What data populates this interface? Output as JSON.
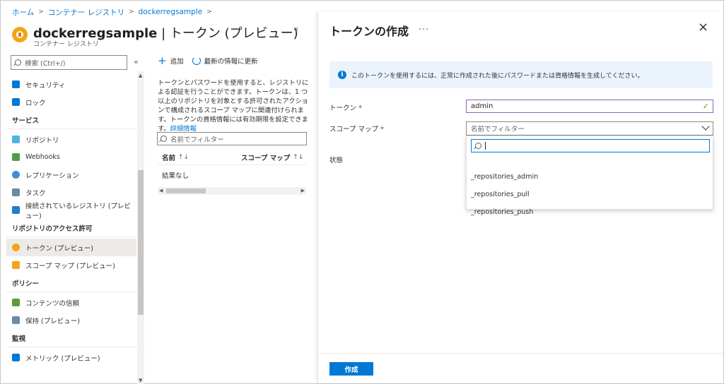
{
  "breadcrumb": [
    "ホーム",
    "コンテナー レジストリ",
    "dockerregsample"
  ],
  "header": {
    "title_bold": "dockerregsample",
    "title_rest": " | トークン (プレビュー)",
    "subtitle": "コンテナー レジストリ",
    "collapse": "«"
  },
  "nav": {
    "search_placeholder": "検索 (Ctrl+/)",
    "collapse": "«",
    "items": [
      {
        "type": "item",
        "label": "セキュリティ",
        "icon": "shield-icon",
        "color": "#0078d4"
      },
      {
        "type": "item",
        "label": "ロック",
        "icon": "lock-icon",
        "color": "#0078d4"
      },
      {
        "type": "section",
        "label": "サービス"
      },
      {
        "type": "item",
        "label": "リポジトリ",
        "icon": "cloud-icon",
        "color": "#50b0e8"
      },
      {
        "type": "item",
        "label": "Webhooks",
        "icon": "webhook-icon",
        "color": "#4c9e4c"
      },
      {
        "type": "item",
        "label": "レプリケーション",
        "icon": "globe-icon",
        "color": "#3b8fd6"
      },
      {
        "type": "item",
        "label": "タスク",
        "icon": "task-icon",
        "color": "#6c8aa0"
      },
      {
        "type": "item",
        "label": "接続されているレジストリ (プレビュー)",
        "icon": "connected-registry-icon",
        "color": "#1f7ed0"
      },
      {
        "type": "section",
        "label": "リポジトリのアクセス許可"
      },
      {
        "type": "item",
        "label": "トークン (プレビュー)",
        "icon": "token-icon",
        "color": "#f2a516",
        "active": true
      },
      {
        "type": "item",
        "label": "スコープ マップ (プレビュー)",
        "icon": "scope-map-icon",
        "color": "#f2a516"
      },
      {
        "type": "section",
        "label": "ポリシー"
      },
      {
        "type": "item",
        "label": "コンテンツの信頼",
        "icon": "content-trust-icon",
        "color": "#5c9e31"
      },
      {
        "type": "item",
        "label": "保持 (プレビュー)",
        "icon": "retention-icon",
        "color": "#6b8aa6"
      },
      {
        "type": "section",
        "label": "監視"
      },
      {
        "type": "item",
        "label": "メトリック (プレビュー)",
        "icon": "metrics-icon",
        "color": "#0078d4"
      }
    ]
  },
  "middle": {
    "add_label": "追加",
    "refresh_label": "最新の情報に更新",
    "description": "トークンとパスワードを使用すると、レジストリによる認証を行うことができます。トークンは、1 つ以上のリポジトリを対象とする許可されたアクションで構成されるスコープ マップに関連付けられます。トークンの資格情報には有効期限を設定できます。",
    "learn_more": "詳細情報",
    "filter_placeholder": "名前でフィルター",
    "columns": [
      "名前",
      "スコープ マップ"
    ],
    "sort_glyph": "↑↓",
    "no_results": "結果なし"
  },
  "blade": {
    "title": "トークンの作成",
    "more": "...",
    "close": "×",
    "info": "このトークンを使用するには、正常に作成された後にパスワードまたは資格情報を生成してください。",
    "token_label": "トークン",
    "token_value": "admin",
    "scope_label": "スコープ マップ",
    "scope_placeholder": "名前でフィルター",
    "status_label": "状態",
    "options": [
      "_repositories_admin",
      "_repositories_pull",
      "_repositories_push"
    ],
    "create_label": "作成"
  },
  "colors": {
    "accent": "#0078d4",
    "required": "#a4262c",
    "valid": "#57a300",
    "focus_border": "#8764b8"
  }
}
